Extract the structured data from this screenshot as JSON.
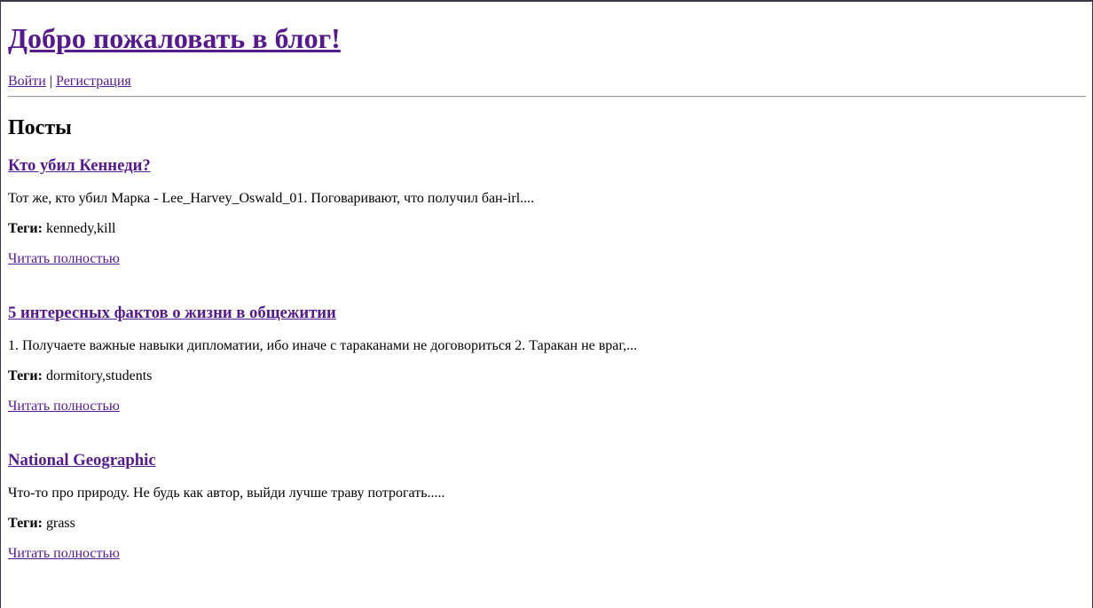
{
  "header": {
    "title": "Добро пожаловать в блог!",
    "login_label": "Войти",
    "separator": "|",
    "register_label": "Регистрация"
  },
  "posts_section": {
    "heading": "Посты",
    "tags_label": "Теги:",
    "read_more_label": "Читать полностью",
    "posts": [
      {
        "title": "Кто убил Кеннеди?",
        "excerpt": "Тот же, кто убил Марка - Lee_Harvey_Oswald_01. Поговаривают, что получил бан-irl....",
        "tags": "kennedy,kill"
      },
      {
        "title": "5 интересных фактов о жизни в общежитии",
        "excerpt": "1. Получаете важные навыки дипломатии, ибо иначе с тараканами не договориться 2. Таракан не враг,...",
        "tags": "dormitory,students"
      },
      {
        "title": "National Geographic",
        "excerpt": "Что-то про природу. Не будь как автор, выйди лучше траву потрогать.....",
        "tags": "grass"
      }
    ]
  }
}
